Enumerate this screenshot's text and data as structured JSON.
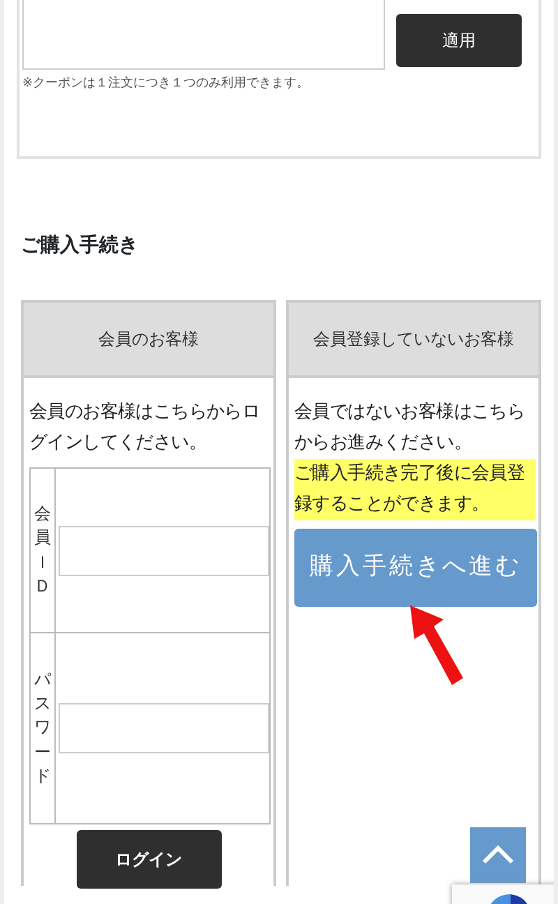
{
  "coupon": {
    "button": "適用",
    "note": "※クーポンは１注文につき１つのみ利用できます。"
  },
  "section_title": "ご購入手続き",
  "members": {
    "header": "会員のお客様",
    "description": "会員のお客様はこちらからログインしてください。",
    "fields": [
      {
        "label": "会員ＩＤ"
      },
      {
        "label": "パスワード"
      }
    ],
    "button": "ログイン"
  },
  "guests": {
    "header": "会員登録していないお客様",
    "description": "会員ではないお客様はこちらからお進みください。",
    "highlight": "ご購入手続き完了後に会員登録することができます。",
    "button": "購入手続きへ進む"
  }
}
